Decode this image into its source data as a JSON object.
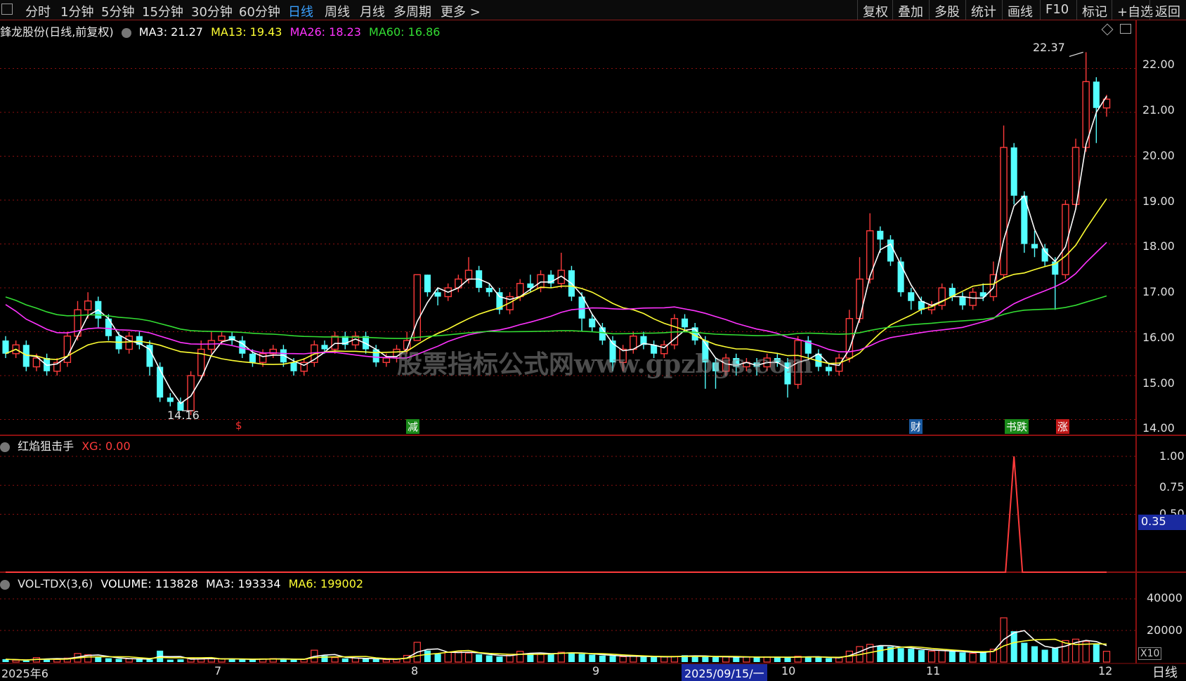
{
  "toolbar": {
    "left": [
      "分时",
      "1分钟",
      "5分钟",
      "15分钟",
      "30分钟",
      "60分钟",
      "日线",
      "周线",
      "月线",
      "多周期",
      "更多 >"
    ],
    "active": "日线",
    "right": [
      "复权",
      "叠加",
      "多股",
      "统计",
      "画线",
      "F10",
      "标记",
      "+自选",
      "返回"
    ]
  },
  "main_panel": {
    "stock_title": "鋒龙股份(日线,前复权)",
    "ma3": "MA3: 21.27",
    "ma13": "MA13: 19.43",
    "ma26": "MA26: 18.23",
    "ma60": "MA60: 16.86",
    "high_label": "22.37",
    "low_label": "14.16",
    "watermark": "股票指标公式网www.gpzbgs.com",
    "price_axis": [
      "22.00",
      "21.00",
      "20.00",
      "19.00",
      "18.00",
      "17.00",
      "16.00",
      "15.00",
      "14.00"
    ],
    "markers": [
      {
        "text": "$",
        "color": "#ff3030",
        "bg": "transparent"
      },
      {
        "text": "减",
        "color": "#ffffff",
        "bg": "#1a8a1a"
      },
      {
        "text": "财",
        "color": "#ffffff",
        "bg": "#1a5aa0"
      },
      {
        "text": "书跌",
        "color": "#ffffff",
        "bg": "#1a8a1a"
      },
      {
        "text": "涨",
        "color": "#ffffff",
        "bg": "#c01818"
      }
    ]
  },
  "indicator_panel": {
    "name": "红焰狙击手",
    "xg": "XG: 0.00",
    "axis": [
      "1.00",
      "0.75",
      "0.50"
    ],
    "current": "0.35"
  },
  "volume_panel": {
    "name": "VOL-TDX(3,6)",
    "volume": "VOLUME: 113828",
    "ma3": "MA3: 193334",
    "ma6": "MA6: 199002",
    "axis": [
      "40000",
      "20000"
    ],
    "unit": "X10"
  },
  "date_axis": {
    "labels": [
      "2025年6",
      "7",
      "8",
      "9",
      "2025/09/15/一",
      "10",
      "11",
      "12"
    ],
    "period": "日线"
  },
  "colors": {
    "up": "#ff3b3b",
    "down": "#54ffff",
    "ma3": "#ffffff",
    "ma13": "#ffff33",
    "ma26": "#ff33ff",
    "ma60": "#33dd33",
    "grid": "#8b1010"
  },
  "chart_data": {
    "type": "candlestick",
    "y_range": [
      13.8,
      22.6
    ],
    "candles": [
      [
        15.8,
        15.5,
        15.9,
        15.4
      ],
      [
        15.5,
        15.7,
        15.8,
        15.4
      ],
      [
        15.7,
        15.2,
        15.8,
        15.1
      ],
      [
        15.2,
        15.4,
        15.5,
        15.1
      ],
      [
        15.4,
        15.1,
        15.5,
        15.0
      ],
      [
        15.1,
        15.3,
        15.4,
        15.0
      ],
      [
        15.3,
        15.9,
        16.0,
        15.2
      ],
      [
        15.9,
        16.5,
        16.7,
        15.8
      ],
      [
        16.5,
        16.7,
        16.9,
        16.3
      ],
      [
        16.7,
        16.3,
        16.8,
        16.1
      ],
      [
        16.3,
        15.9,
        16.4,
        15.8
      ],
      [
        15.9,
        15.6,
        16.0,
        15.5
      ],
      [
        15.6,
        15.9,
        16.0,
        15.5
      ],
      [
        15.9,
        15.7,
        16.0,
        15.6
      ],
      [
        15.7,
        15.2,
        15.8,
        15.0
      ],
      [
        15.2,
        14.5,
        15.3,
        14.4
      ],
      [
        14.5,
        14.4,
        14.6,
        14.3
      ],
      [
        14.4,
        14.2,
        14.5,
        14.2
      ],
      [
        14.2,
        15.0,
        15.1,
        14.1
      ],
      [
        15.0,
        15.6,
        15.8,
        14.9
      ],
      [
        15.6,
        15.8,
        16.0,
        15.5
      ],
      [
        15.8,
        15.9,
        16.0,
        15.7
      ],
      [
        15.9,
        15.8,
        16.0,
        15.7
      ],
      [
        15.8,
        15.5,
        15.9,
        15.4
      ],
      [
        15.5,
        15.3,
        15.6,
        15.2
      ],
      [
        15.3,
        15.5,
        15.6,
        15.2
      ],
      [
        15.5,
        15.6,
        15.7,
        15.4
      ],
      [
        15.6,
        15.3,
        15.7,
        15.2
      ],
      [
        15.3,
        15.1,
        15.4,
        15.0
      ],
      [
        15.1,
        15.3,
        15.4,
        15.0
      ],
      [
        15.3,
        15.7,
        15.8,
        15.2
      ],
      [
        15.7,
        15.6,
        15.8,
        15.5
      ],
      [
        15.6,
        15.9,
        16.0,
        15.5
      ],
      [
        15.9,
        15.7,
        16.0,
        15.6
      ],
      [
        15.7,
        15.9,
        16.0,
        15.6
      ],
      [
        15.9,
        15.6,
        16.0,
        15.5
      ],
      [
        15.6,
        15.3,
        15.7,
        15.2
      ],
      [
        15.3,
        15.4,
        15.5,
        15.2
      ],
      [
        15.4,
        15.6,
        15.7,
        15.3
      ],
      [
        15.6,
        15.8,
        16.0,
        15.5
      ],
      [
        15.8,
        17.3,
        17.3,
        15.8
      ],
      [
        17.3,
        16.9,
        17.3,
        16.8
      ],
      [
        16.9,
        16.8,
        17.0,
        16.6
      ],
      [
        16.8,
        17.0,
        17.1,
        16.7
      ],
      [
        17.0,
        17.2,
        17.3,
        16.9
      ],
      [
        17.2,
        17.4,
        17.7,
        17.1
      ],
      [
        17.4,
        17.0,
        17.5,
        16.9
      ],
      [
        17.0,
        16.9,
        17.1,
        16.8
      ],
      [
        16.9,
        16.5,
        17.0,
        16.4
      ],
      [
        16.5,
        16.8,
        16.9,
        16.4
      ],
      [
        16.8,
        17.1,
        17.2,
        16.7
      ],
      [
        17.1,
        17.0,
        17.3,
        16.9
      ],
      [
        17.0,
        17.3,
        17.4,
        16.9
      ],
      [
        17.3,
        17.1,
        17.4,
        17.0
      ],
      [
        17.1,
        17.4,
        17.8,
        17.0
      ],
      [
        17.4,
        16.8,
        17.5,
        16.7
      ],
      [
        16.8,
        16.3,
        16.9,
        16.0
      ],
      [
        16.3,
        16.1,
        16.4,
        16.0
      ],
      [
        16.1,
        15.8,
        16.2,
        15.7
      ],
      [
        15.8,
        15.3,
        15.9,
        15.1
      ],
      [
        15.3,
        15.6,
        15.7,
        15.1
      ],
      [
        15.6,
        15.9,
        16.0,
        15.5
      ],
      [
        15.9,
        15.7,
        16.0,
        15.6
      ],
      [
        15.7,
        15.5,
        15.8,
        15.4
      ],
      [
        15.5,
        15.7,
        15.8,
        15.4
      ],
      [
        15.7,
        16.3,
        16.4,
        15.6
      ],
      [
        16.3,
        16.1,
        16.4,
        16.0
      ],
      [
        16.1,
        15.8,
        16.2,
        15.7
      ],
      [
        15.8,
        15.3,
        15.9,
        14.7
      ],
      [
        15.3,
        15.1,
        15.4,
        14.7
      ],
      [
        15.1,
        15.4,
        15.5,
        15.0
      ],
      [
        15.4,
        15.2,
        15.5,
        15.0
      ],
      [
        15.2,
        15.3,
        15.4,
        15.1
      ],
      [
        15.3,
        15.2,
        15.4,
        15.0
      ],
      [
        15.2,
        15.4,
        15.5,
        15.1
      ],
      [
        15.4,
        15.3,
        15.5,
        15.2
      ],
      [
        15.3,
        14.8,
        15.4,
        14.5
      ],
      [
        14.8,
        15.8,
        15.9,
        14.7
      ],
      [
        15.8,
        15.5,
        15.9,
        15.4
      ],
      [
        15.5,
        15.2,
        15.6,
        15.1
      ],
      [
        15.2,
        15.1,
        15.3,
        15.0
      ],
      [
        15.1,
        15.4,
        15.5,
        15.0
      ],
      [
        15.4,
        16.3,
        16.5,
        15.3
      ],
      [
        16.3,
        17.2,
        17.7,
        16.2
      ],
      [
        17.2,
        18.3,
        18.7,
        17.1
      ],
      [
        18.3,
        18.1,
        18.4,
        17.8
      ],
      [
        18.1,
        17.6,
        18.2,
        17.5
      ],
      [
        17.6,
        16.9,
        17.7,
        16.8
      ],
      [
        16.9,
        16.7,
        17.0,
        16.5
      ],
      [
        16.7,
        16.5,
        16.8,
        16.4
      ],
      [
        16.5,
        16.6,
        16.7,
        16.4
      ],
      [
        16.6,
        17.0,
        17.1,
        16.5
      ],
      [
        17.0,
        16.8,
        17.1,
        16.7
      ],
      [
        16.8,
        16.6,
        16.9,
        16.5
      ],
      [
        16.6,
        16.9,
        17.0,
        16.5
      ],
      [
        16.9,
        16.8,
        17.1,
        16.7
      ],
      [
        16.8,
        17.3,
        17.6,
        16.7
      ],
      [
        17.3,
        20.2,
        20.7,
        17.2
      ],
      [
        20.2,
        19.1,
        20.3,
        18.9
      ],
      [
        19.1,
        18.0,
        19.2,
        17.8
      ],
      [
        18.0,
        17.9,
        18.3,
        17.7
      ],
      [
        17.9,
        17.6,
        18.0,
        17.5
      ],
      [
        17.6,
        17.3,
        17.7,
        16.5
      ],
      [
        17.3,
        18.9,
        19.0,
        17.2
      ],
      [
        18.9,
        20.2,
        20.4,
        18.8
      ],
      [
        20.2,
        21.7,
        22.37,
        20.1
      ],
      [
        21.7,
        21.1,
        21.8,
        20.3
      ],
      [
        21.1,
        21.3,
        21.4,
        20.9
      ]
    ],
    "volume": [
      1800,
      1200,
      900,
      2800,
      2200,
      1600,
      2500,
      5400,
      4600,
      3500,
      2400,
      2000,
      2100,
      1900,
      1600,
      7200,
      1500,
      1700,
      2400,
      1900,
      2200,
      2100,
      1800,
      1700,
      1600,
      2000,
      2200,
      1900,
      1500,
      1700,
      7500,
      4000,
      2800,
      2300,
      2600,
      2100,
      1800,
      1500,
      1900,
      4200,
      12500,
      7300,
      5200,
      6100,
      6800,
      5700,
      4900,
      4200,
      3500,
      4300,
      6800,
      5500,
      4900,
      5600,
      6200,
      5800,
      5200,
      4700,
      4100,
      3900,
      3400,
      3800,
      3500,
      3100,
      3300,
      3600,
      4300,
      3800,
      3500,
      3100,
      3300,
      3200,
      3200,
      2900,
      3300,
      3100,
      2700,
      3700,
      3500,
      2900,
      2500,
      2800,
      6900,
      9800,
      11200,
      10200,
      9700,
      8800,
      8400,
      7600,
      6900,
      7300,
      6800,
      6100,
      5500,
      6700,
      8100,
      28000,
      19500,
      12200,
      10000,
      7800,
      8900,
      13600,
      14500,
      13000,
      11400,
      6800
    ]
  }
}
